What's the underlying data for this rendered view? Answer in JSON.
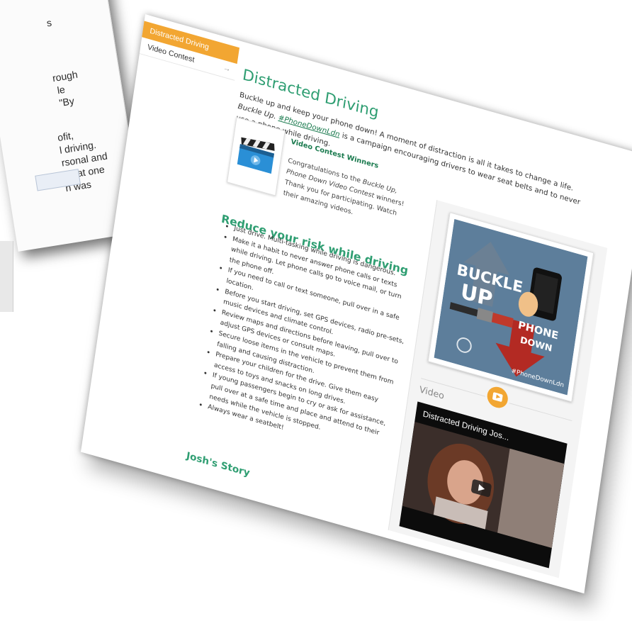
{
  "background_doc": {
    "lines": [
      "s",
      "rough",
      "le",
      "\"By",
      "ofit,",
      "l driving.",
      "rsonal and",
      "t that one",
      "h was"
    ]
  },
  "sidenav": {
    "items": [
      {
        "label": "Distracted Driving"
      },
      {
        "label": "Video Contest"
      }
    ],
    "arrow": "→"
  },
  "main": {
    "title": "Distracted Driving",
    "intro_lead": "Buckle up and keep your phone down! A moment of distraction is all it takes to change a life.",
    "intro_italic": "Buckle Up.",
    "hashtag": "#PhoneDownLdn",
    "intro_rest": "is a campaign encouraging drivers to wear seat belts and to never use a phone while driving."
  },
  "contest": {
    "title": "Video Contest Winners",
    "body_lead": "Congratulations to the",
    "body_italic": "Buckle Up, Phone Down Video Contest",
    "body_rest": "winners! Thank you for participating. Watch their amazing videos."
  },
  "reduce": {
    "title": "Reduce your risk while driving",
    "tips": [
      "Just drive. Multi-tasking while driving is dangerous.",
      "Make it a habit to never answer phone calls or texts while driving. Let phone calls go to voice mail, or turn the phone off.",
      "If you need to call or text someone, pull over in a safe location.",
      "Before you start driving, set GPS devices, radio pre-sets, music devices and climate control.",
      "Review maps and directions before leaving, pull over to adjust GPS devices or consult maps.",
      "Secure loose items in the vehicle to prevent them from falling and causing distraction.",
      "Prepare your children for the drive. Give them easy access to toys and snacks on long drives.",
      "If young passengers begin to cry or ask for assistance, pull over at a safe time and place and attend to their needs while the vehicle is stopped.",
      "Always wear a seatbelt!"
    ]
  },
  "josh": {
    "title": "Josh's Story"
  },
  "poster": {
    "word1": "BUCKLE",
    "word2": "UP",
    "word3": "PHONE",
    "word4": "DOWN",
    "hashtag": "#PhoneDownLdn"
  },
  "video": {
    "label": "Video",
    "title": "Distracted Driving Jos..."
  },
  "colors": {
    "accent": "#f2a632",
    "heading_green": "#2f9e72",
    "poster_bg": "#5d7e9b"
  }
}
